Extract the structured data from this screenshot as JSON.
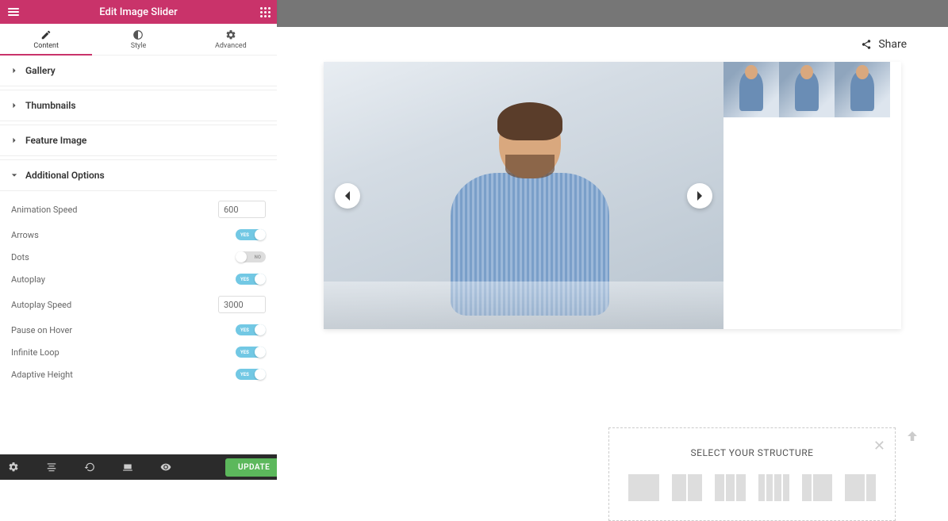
{
  "header": {
    "title": "Edit Image Slider"
  },
  "tabs": {
    "content": "Content",
    "style": "Style",
    "advanced": "Advanced"
  },
  "sections": {
    "gallery": "Gallery",
    "thumbnails": "Thumbnails",
    "feature_image": "Feature Image",
    "additional": "Additional Options"
  },
  "options": {
    "animation_speed_label": "Animation Speed",
    "animation_speed_value": "600",
    "arrows_label": "Arrows",
    "dots_label": "Dots",
    "autoplay_label": "Autoplay",
    "autoplay_speed_label": "Autoplay Speed",
    "autoplay_speed_value": "3000",
    "pause_label": "Pause on Hover",
    "infinite_label": "Infinite Loop",
    "adaptive_label": "Adaptive Height",
    "yes": "YES",
    "no": "NO"
  },
  "bottom": {
    "update": "UPDATE"
  },
  "share": {
    "label": "Share"
  },
  "structure": {
    "title": "SELECT YOUR STRUCTURE"
  },
  "colors": {
    "accent": "#c9336a",
    "toggle_on": "#72c8e4",
    "success": "#5cb85c"
  }
}
